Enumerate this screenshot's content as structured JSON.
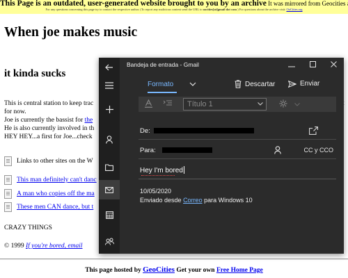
{
  "banner": {
    "headline": "This Page is an outdated, user-generated website brought to you by an archive",
    "mirror_note": "It was mirrored from Geocities at the end of October, 2009.",
    "contact_note": "For any questions concerning this page try to contact the respective author. (To report any malicious content send the URL to",
    "contact_email": "oocities[at]gmail dot com",
    "contact_tail": ") For questions about the archive visit:",
    "archive_link": "OoCities.org"
  },
  "page": {
    "title": "When joe makes music",
    "subtitle": "it kinda sucks",
    "intro_lines": [
      "This is central station to keep trac",
      "for now.",
      "Joe is currently the bassist for",
      "He is also currently involved in th",
      "HEY HEY...a first for Joe...check"
    ],
    "intro_link": "the",
    "right_edge_char": "t",
    "links_heading": "Links to other sites on the W",
    "link_items": [
      "This man definitely can't danc",
      "A man who copies off the ma",
      "These men CAN dance, but t"
    ],
    "crazy_things": "CRAZY THINGS",
    "copyright_prefix": "© 1999",
    "copyright_link": "If you're bored, email",
    "hosted_prefix": "This page hosted by",
    "hosted_brand": "GeoCities",
    "hosted_middle": "Get your own",
    "hosted_link": "Free Home Page"
  },
  "mail": {
    "window_title": "Bandeja de entrada - Gmail",
    "tab_format": "Formato",
    "discard_label": "Descartar",
    "send_label": "Enviar",
    "style_value": "Título 1",
    "from_label": "De:",
    "to_label": "Para:",
    "cc_label": "CC y CCO",
    "subject": "Hey I'm bored",
    "body_date": "10/05/2020",
    "signature_prefix": "Enviado desde",
    "signature_link": "Correo",
    "signature_suffix": "para Windows 10"
  },
  "colors": {
    "banner_bg": "#ffff99",
    "link_blue": "#0000ee",
    "mail_bg": "#2b2b2b",
    "mail_accent": "#79b8ff"
  }
}
